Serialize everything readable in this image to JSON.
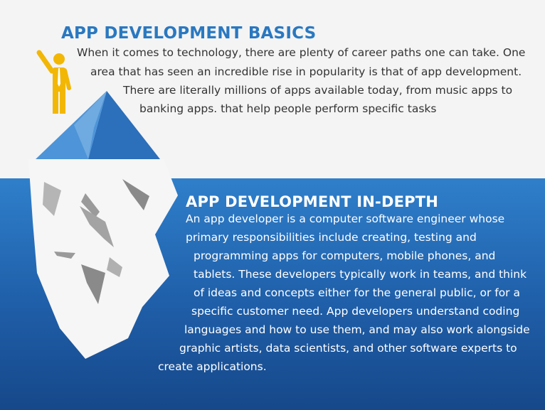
{
  "basics": {
    "title": "APP DEVELOPMENT BASICS",
    "lines": [
      "When it comes to technology, there are plenty of career paths one can take. One",
      "area that has seen an incredible rise in popularity is that of app development.",
      "There are literally millions of apps available today, from music apps to",
      "banking apps. that help people perform specific tasks"
    ]
  },
  "depth": {
    "title": "APP DEVELOPMENT IN-DEPTH",
    "lines": [
      "An app developer is a computer software engineer whose",
      "primary responsibilities include creating, testing and",
      "programming apps for computers, mobile phones, and",
      "tablets. These developers typically work in teams, and think",
      "of ideas and concepts either for the general public, or for a",
      "specific customer need. App developers understand coding",
      "languages and how to use them, and may also work alongside",
      "graphic artists, data scientists, and other software experts to",
      "create applications."
    ]
  },
  "colors": {
    "title_blue": "#2a78c0",
    "figure_yellow": "#f2b705",
    "water_blue": "#2f7fcb",
    "ice_white": "#f6f6f6",
    "crack_gray": "#8a8a8a"
  },
  "icons": {
    "figure": "person-pointing-icon",
    "iceberg": "iceberg-icon"
  }
}
